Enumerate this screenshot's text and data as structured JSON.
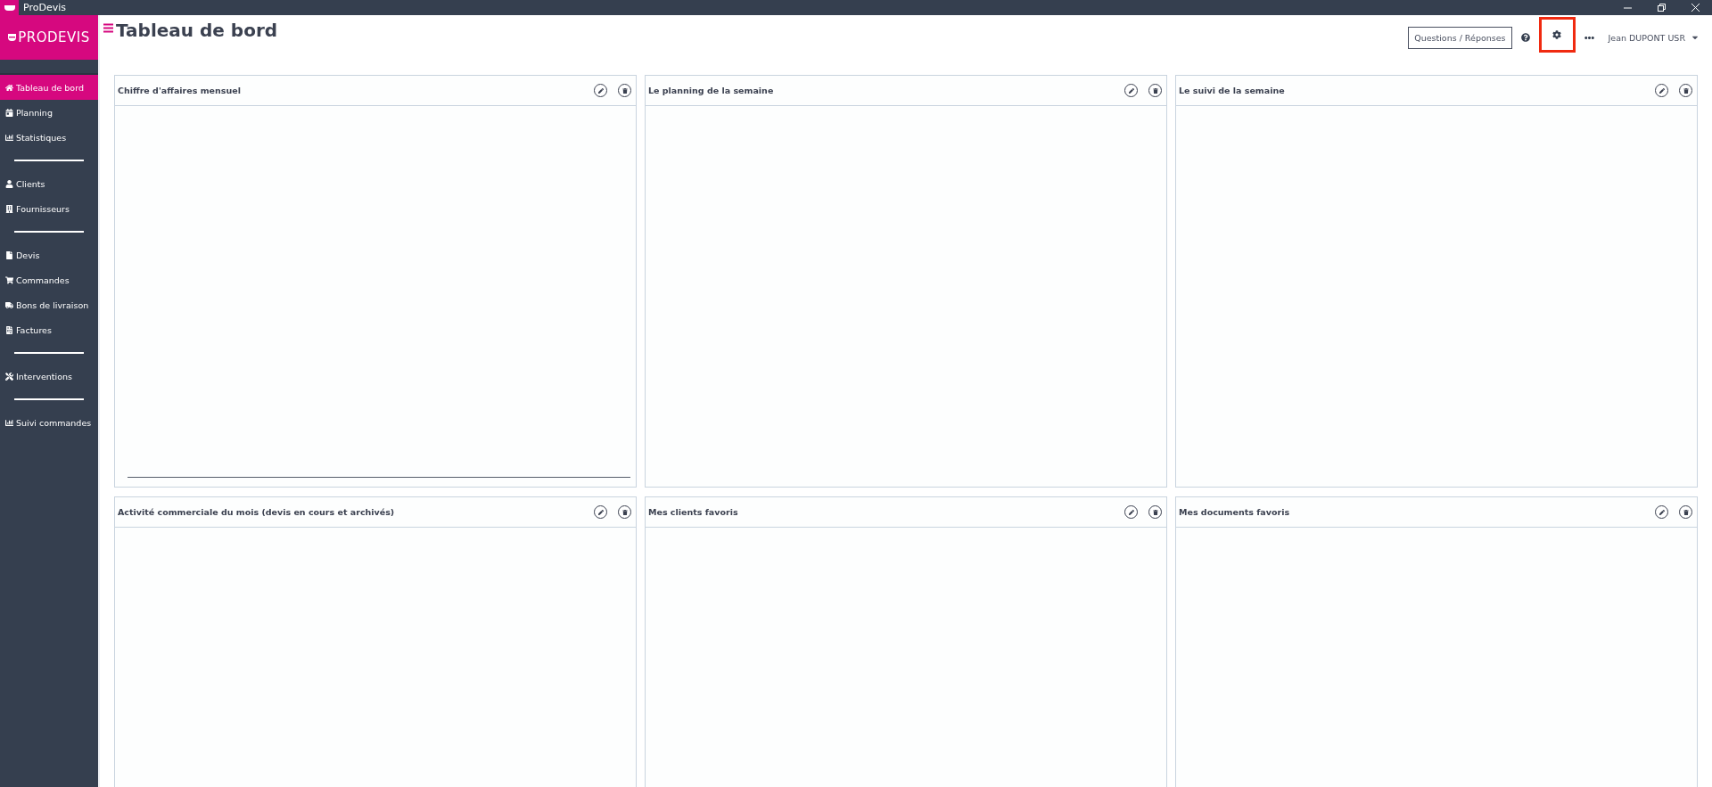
{
  "window": {
    "title": "ProDevis"
  },
  "sidebar": {
    "logo": "PRODEVIS",
    "items": [
      {
        "kind": "link",
        "label": "Tableau de bord",
        "selected": true
      },
      {
        "kind": "link",
        "label": "Planning",
        "selected": false
      },
      {
        "kind": "link",
        "label": "Statistiques",
        "selected": false
      },
      {
        "kind": "divider"
      },
      {
        "kind": "link",
        "label": "Clients",
        "selected": false
      },
      {
        "kind": "link",
        "label": "Fournisseurs",
        "selected": false
      },
      {
        "kind": "divider"
      },
      {
        "kind": "link",
        "label": "Devis",
        "selected": false
      },
      {
        "kind": "link",
        "label": "Commandes",
        "selected": false
      },
      {
        "kind": "link",
        "label": "Bons de livraison",
        "selected": false
      },
      {
        "kind": "link",
        "label": "Factures",
        "selected": false
      },
      {
        "kind": "divider"
      },
      {
        "kind": "link",
        "label": "Interventions",
        "selected": false
      },
      {
        "kind": "divider"
      },
      {
        "kind": "link",
        "label": "Suivi commandes",
        "selected": false
      }
    ]
  },
  "header": {
    "title": "Tableau de bord",
    "faq_button": "Questions / Réponses",
    "settings_highlighted": true,
    "user": "Jean DUPONT USR"
  },
  "widgets": [
    {
      "title": "Chiffre d'affaires mensuel",
      "axis": true
    },
    {
      "title": "Le planning de la semaine",
      "axis": false
    },
    {
      "title": "Le suivi de la semaine",
      "axis": false
    },
    {
      "title": "Activité commerciale du mois (devis en cours et archivés)",
      "axis": false
    },
    {
      "title": "Mes clients favoris",
      "axis": false
    },
    {
      "title": "Mes documents favoris",
      "axis": false
    }
  ]
}
